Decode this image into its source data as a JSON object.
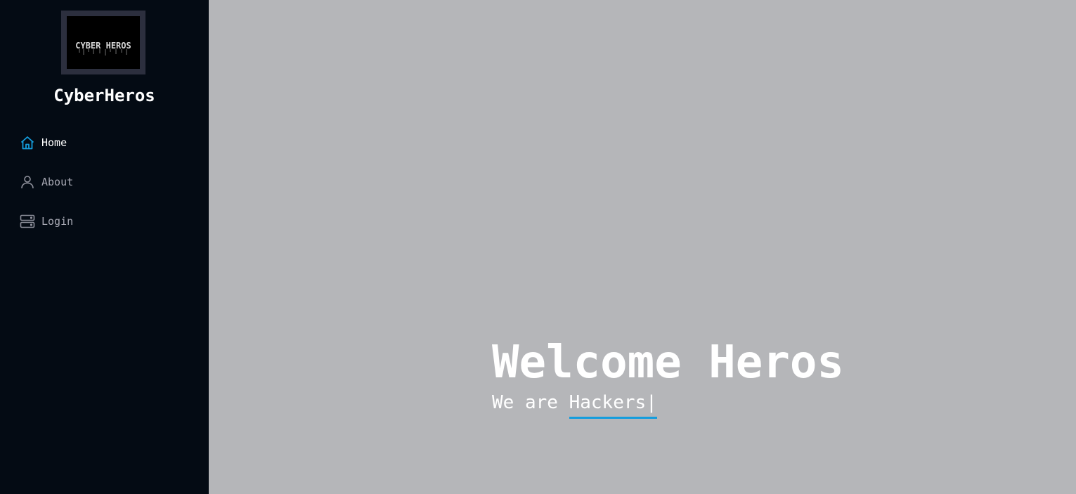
{
  "sidebar": {
    "logo_text": "CYBER HEROS",
    "brand": "CyberHeros",
    "items": [
      {
        "label": "Home",
        "icon": "house-icon",
        "active": true
      },
      {
        "label": "About",
        "icon": "person-icon",
        "active": false
      },
      {
        "label": "Login",
        "icon": "server-icon",
        "active": false
      }
    ]
  },
  "hero": {
    "title": "Welcome Heros",
    "subtitle_prefix": "We are ",
    "typed_word": "Hackers",
    "cursor": "|"
  },
  "colors": {
    "sidebar_bg": "#040b14",
    "main_bg": "#b5b6b9",
    "accent": "#149ddd",
    "nav_text": "#a8a9b4",
    "active_text": "#ffffff"
  }
}
